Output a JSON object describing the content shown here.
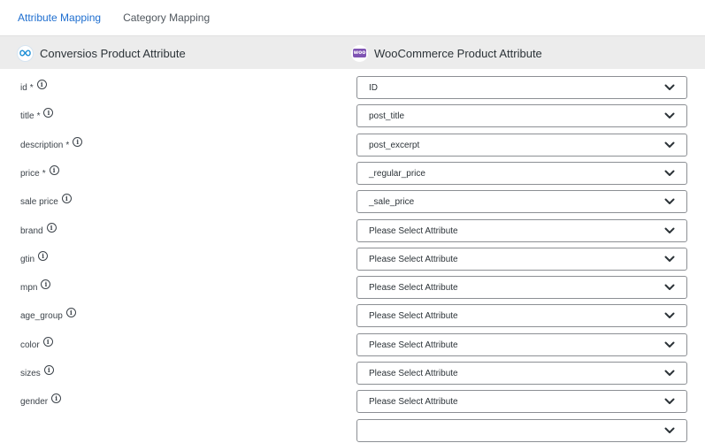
{
  "tabs": [
    {
      "label": "Attribute Mapping",
      "active": true
    },
    {
      "label": "Category Mapping",
      "active": false
    }
  ],
  "header": {
    "left_title": "Conversios Product Attribute",
    "right_title": "WooCommerce Product Attribute",
    "woo_badge": "woo"
  },
  "rows": [
    {
      "label": "id",
      "required": "*",
      "value": "ID"
    },
    {
      "label": "title",
      "required": "*",
      "value": "post_title"
    },
    {
      "label": "description",
      "required": "*",
      "value": "post_excerpt"
    },
    {
      "label": "price",
      "required": "*",
      "value": "_regular_price"
    },
    {
      "label": "sale price",
      "required": "",
      "value": "_sale_price"
    },
    {
      "label": "brand",
      "required": "",
      "value": "Please Select Attribute"
    },
    {
      "label": "gtin",
      "required": "",
      "value": "Please Select Attribute"
    },
    {
      "label": "mpn",
      "required": "",
      "value": "Please Select Attribute"
    },
    {
      "label": "age_group",
      "required": "",
      "value": "Please Select Attribute"
    },
    {
      "label": "color",
      "required": "",
      "value": "Please Select Attribute"
    },
    {
      "label": "sizes",
      "required": "",
      "value": "Please Select Attribute"
    },
    {
      "label": "gender",
      "required": "",
      "value": "Please Select Attribute"
    },
    {
      "label": "",
      "required": "",
      "value": ""
    }
  ],
  "info_glyph": "i",
  "colors": {
    "accent": "#1e6ecf",
    "header_bg": "#ececec",
    "border": "#8c8f94"
  }
}
